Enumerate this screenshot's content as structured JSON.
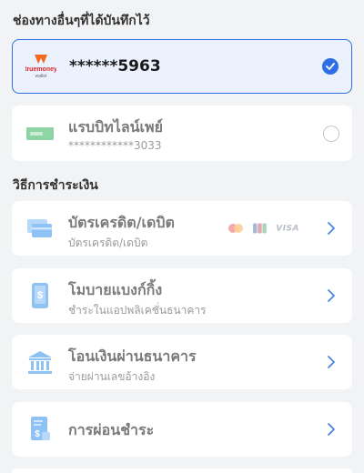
{
  "saved_section": {
    "title": "ช่องทางอื่นๆที่ได้บันทึกไว้",
    "items": [
      {
        "logo_text": "truemoney",
        "logo_sub": "wallet",
        "label": "******5963",
        "selected": true
      },
      {
        "label": "แรบบิทไลน์เพย์",
        "sub": "************3033",
        "selected": false
      }
    ]
  },
  "methods_section": {
    "title": "วิธีการชำระเงิน",
    "items": [
      {
        "title": "บัตรเครดิต/เดบิต",
        "sub": "บัตรเครดิต/เดบิต",
        "icon": "credit-card-icon",
        "brand_visa": "VISA"
      },
      {
        "title": "โมบายแบงก์กิ้ง",
        "sub": "ชำระในแอปพลิเคชั่นธนาคาร",
        "icon": "mobile-banking-icon"
      },
      {
        "title": "โอนเงินผ่านธนาคาร",
        "sub": "จ่ายผ่านเลขอ้างอิง",
        "icon": "bank-icon"
      },
      {
        "title": "การผ่อนชำระ",
        "icon": "installment-icon"
      }
    ]
  },
  "colors": {
    "accent": "#2f6fe6",
    "icon_blue": "#8ec2f5",
    "truemoney_orange": "#f26a21",
    "rabbit_green": "#8fd4a4"
  }
}
